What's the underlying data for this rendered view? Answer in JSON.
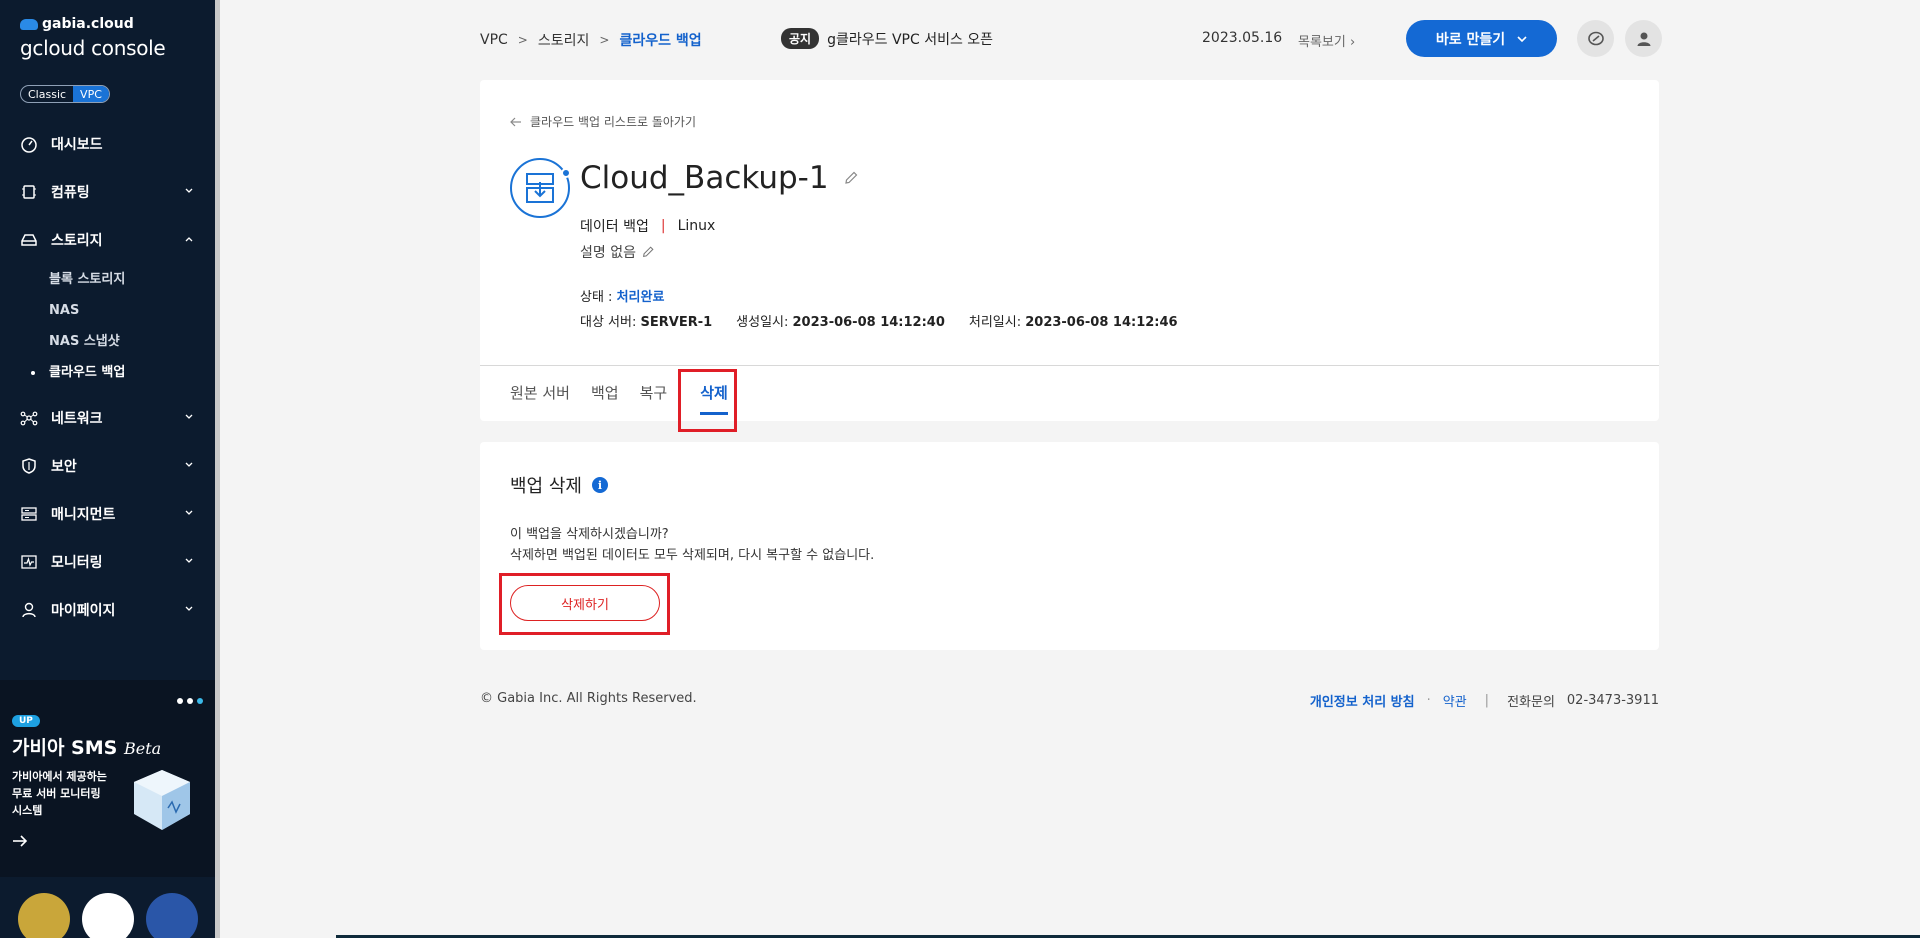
{
  "sidebar": {
    "brand_small": "gabia.cloud",
    "brand_big": "gcloud console",
    "toggle": {
      "classic": "Classic",
      "vpc": "VPC"
    },
    "items": [
      {
        "label": "대시보드"
      },
      {
        "label": "컴퓨팅"
      },
      {
        "label": "스토리지"
      },
      {
        "label": "네트워크"
      },
      {
        "label": "보안"
      },
      {
        "label": "매니지먼트"
      },
      {
        "label": "모니터링"
      },
      {
        "label": "마이페이지"
      }
    ],
    "storage_sub": [
      {
        "label": "블록 스토리지"
      },
      {
        "label": "NAS"
      },
      {
        "label": "NAS 스냅샷"
      },
      {
        "label": "클라우드 백업"
      }
    ],
    "promo": {
      "badge": "UP",
      "title": "가비아 SMS",
      "title_suffix": "Beta",
      "desc": "가비아에서 제공하는\n무료 서버 모니터링\n시스템"
    }
  },
  "header": {
    "breadcrumb": [
      "VPC",
      "스토리지",
      "클라우드 백업"
    ],
    "notice_tag": "공지",
    "notice_text": "g클라우드 VPC 서비스 오픈",
    "notice_date": "2023.05.16",
    "list_link": "목록보기",
    "make_button": "바로 만들기"
  },
  "detail": {
    "back_link": "클라우드 백업 리스트로 돌아가기",
    "title": "Cloud_Backup-1",
    "type": "데이터 백업",
    "os": "Linux",
    "description": "설명 없음",
    "status_label": "상태 : ",
    "status_value": "처리완료",
    "target_label": "대상 서버: ",
    "target_value": "SERVER-1",
    "created_label": "생성일시: ",
    "created_value": "2023-06-08 14:12:40",
    "processed_label": "처리일시: ",
    "processed_value": "2023-06-08 14:12:46",
    "tabs": [
      "원본 서버",
      "백업",
      "복구",
      "삭제"
    ]
  },
  "delete_section": {
    "title": "백업 삭제",
    "line1": "이 백업을 삭제하시겠습니까?",
    "line2": "삭제하면 백업된 데이터도 모두 삭제되며, 다시 복구할 수 없습니다.",
    "button": "삭제하기"
  },
  "footer": {
    "copyright": "© Gabia Inc. All Rights Reserved.",
    "privacy": "개인정보 처리 방침",
    "terms": "약관",
    "phone_label": "전화문의",
    "phone": "02-3473-3911"
  },
  "colors": {
    "accent": "#1469d4",
    "sidebar_bg": "#0c1b2e",
    "danger": "#d22222",
    "highlight": "#e01e27"
  }
}
